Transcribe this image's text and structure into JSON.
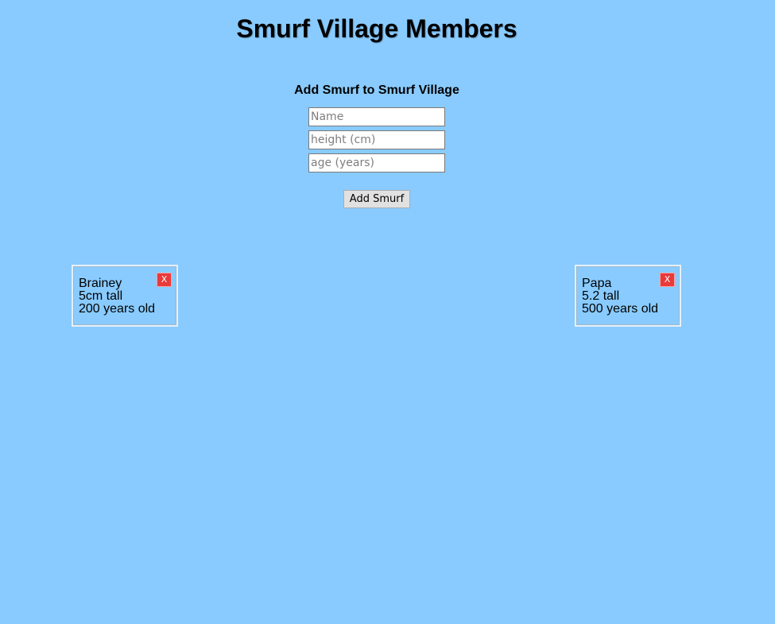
{
  "page": {
    "title": "Smurf Village Members",
    "background_color": "#89cbff"
  },
  "form": {
    "heading": "Add Smurf to Smurf Village",
    "name_placeholder": "Name",
    "height_placeholder": "height (cm)",
    "age_placeholder": "age (years)",
    "submit_label": "Add Smurf"
  },
  "members": [
    {
      "name": "Brainey",
      "height_text": "5cm tall",
      "age_text": "200 years old",
      "remove_label": "X"
    },
    {
      "name": "Papa",
      "height_text": "5.2 tall",
      "age_text": "500 years old",
      "remove_label": "X"
    }
  ],
  "colors": {
    "remove_button": "#e93a3a",
    "button_face": "#e1e1e1"
  }
}
